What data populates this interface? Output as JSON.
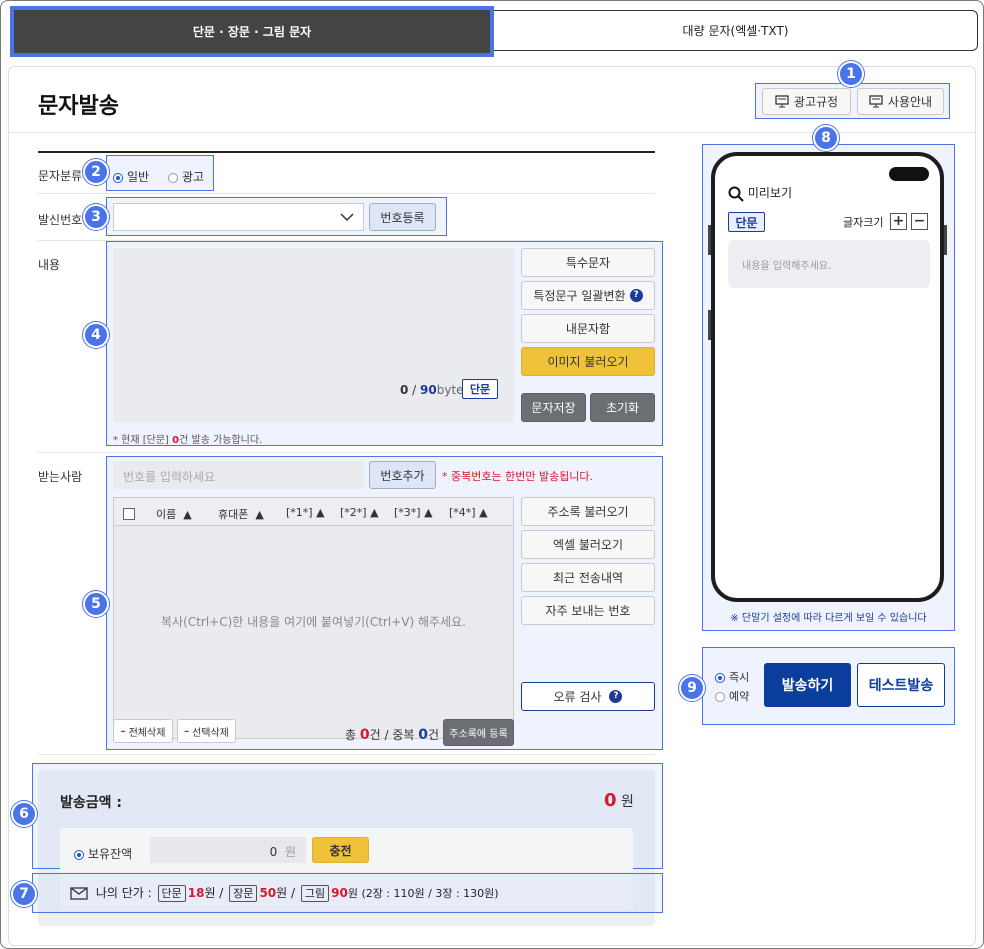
{
  "tabs": [
    {
      "label": "단문 · 장문 · 그림 문자",
      "active": true
    },
    {
      "label": "대량 문자(엑셀·TXT)",
      "active": false
    }
  ],
  "page_title": "문자발송",
  "header_buttons": {
    "ad_rules": "광고규정",
    "guide": "사용안내"
  },
  "badges": [
    "1",
    "2",
    "3",
    "4",
    "5",
    "6",
    "7",
    "8",
    "9"
  ],
  "category": {
    "label": "문자분류",
    "options": [
      "일반",
      "광고"
    ],
    "selected": "일반"
  },
  "sender": {
    "label": "발신번호",
    "value": "",
    "register_button": "번호등록"
  },
  "content": {
    "label": "내용",
    "byte_current": "0",
    "byte_max": "90",
    "byte_unit": "byte",
    "type_tag": "단문",
    "note_prefix": "* 현재 [단문]",
    "note_count": "0",
    "note_suffix": "건 발송 가능합니다.",
    "side_buttons": {
      "special_chars": "특수문자",
      "bulk_convert": "특정문구 일괄변환",
      "my_messages": "내문자함",
      "load_image": "이미지 불러오기",
      "save_message": "문자저장",
      "reset": "초기화"
    }
  },
  "recipients": {
    "label": "받는사람",
    "input_placeholder": "번호를 입력하세요",
    "add_button": "번호추가",
    "duplicate_notice": "* 중복번호는 한번만 발송됩니다.",
    "columns": [
      "이름",
      "휴대폰",
      "[*1*]",
      "[*2*]",
      "[*3*]",
      "[*4*]"
    ],
    "paste_hint": "복사(Ctrl+C)한 내용을 여기에 붙여넣기(Ctrl+V) 해주세요.",
    "side_buttons": {
      "address_book": "주소록 불러오기",
      "excel": "엑셀 불러오기",
      "recent": "최근 전송내역",
      "frequent": "자주 보내는 번호",
      "error_check": "오류 검사"
    },
    "delete_all": "전체삭제",
    "delete_selected": "선택삭제",
    "total_label": "총",
    "total_count": "0",
    "count_unit": "건",
    "dup_label": "/ 중복",
    "dup_count": "0",
    "dup_unit": "건",
    "add_to_book": "주소록에 등록"
  },
  "payment": {
    "label": "발송금액 :",
    "amount": "0",
    "currency": "원",
    "balance_label": "보유잔액",
    "balance_value": "0",
    "balance_unit": "원",
    "charge_button": "충전"
  },
  "unit_price": {
    "label": "나의 단가 :",
    "sms_tag": "단문",
    "sms_price": "18",
    "sms_unit": "원 /",
    "lms_tag": "장문",
    "lms_price": "50",
    "lms_unit": "원 /",
    "mms_tag": "그림",
    "mms_price": "90",
    "mms_unit": "원 (2장 : 110원 / 3장 : 130원)"
  },
  "preview": {
    "title": "미리보기",
    "type_tag": "단문",
    "font_size_label": "글자크기",
    "placeholder": "내용을 입력해주세요.",
    "footnote": "※ 단말기 설정에 따라 다르게 보일 수 있습니다"
  },
  "send": {
    "options": [
      "즉시",
      "예약"
    ],
    "selected": "즉시",
    "send_button": "발송하기",
    "test_button": "테스트발송"
  },
  "colors": {
    "accent": "#4a74e8",
    "primary": "#0b3d9c",
    "yellow": "#f0c23a",
    "red": "#d9172e"
  }
}
